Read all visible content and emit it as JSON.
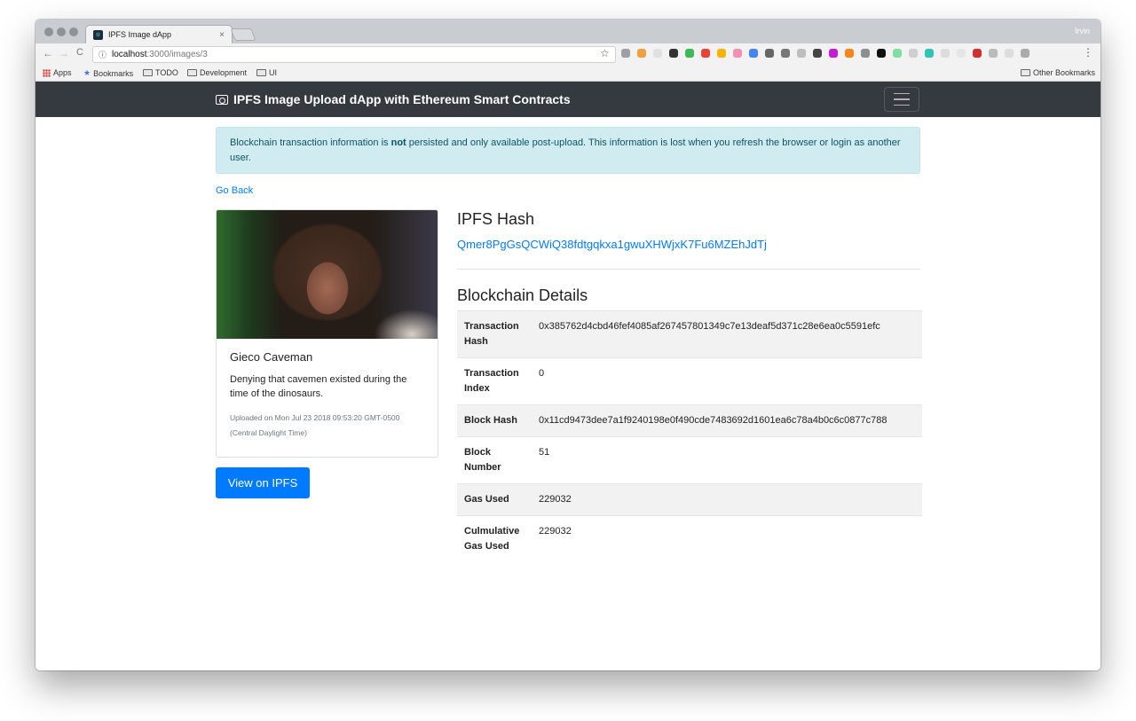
{
  "browser": {
    "tab_title": "IPFS Image dApp",
    "tab_close": "×",
    "profile_name": "Irvin",
    "url_host": "localhost",
    "url_path": ":3000/images/3",
    "bookmarks": [
      "Apps",
      "Bookmarks",
      "TODO",
      "Development",
      "UI"
    ],
    "other_bookmarks": "Other Bookmarks"
  },
  "navbar": {
    "brand": "IPFS Image Upload dApp with Ethereum Smart Contracts"
  },
  "alert": {
    "prefix": "Blockchain transaction information is ",
    "bold": "not",
    "suffix": " persisted and only available post-upload. This information is lost when you refresh the browser or login as another user."
  },
  "go_back": "Go Back",
  "card": {
    "title": "Gieco Caveman",
    "description": "Denying that cavemen existed during the time of the dinosaurs.",
    "uploaded": "Uploaded on Mon Jul 23 2018 09:53:20 GMT-0500 (Central Daylight Time)"
  },
  "view_button": "View on IPFS",
  "ipfs": {
    "heading": "IPFS Hash",
    "hash": "Qmer8PgGsQCWiQ38fdtgqkxa1gwuXHWjxK7Fu6MZEhJdTj"
  },
  "blockchain": {
    "heading": "Blockchain Details",
    "rows": [
      {
        "label": "Transaction Hash",
        "value": "0x385762d4cbd46fef4085af267457801349c7e13deaf5d371c28e6ea0c5591efc"
      },
      {
        "label": "Transaction Index",
        "value": "0"
      },
      {
        "label": "Block Hash",
        "value": "0x11cd9473dee7a1f9240198e0f490cde7483692d1601ea6c78a4b0c6c0877c788"
      },
      {
        "label": "Block Number",
        "value": "51"
      },
      {
        "label": "Gas Used",
        "value": "229032"
      },
      {
        "label": "Culmulative Gas Used",
        "value": "229032"
      }
    ]
  },
  "colors": {
    "navbar_bg": "#343a40",
    "link": "#007bff",
    "alert_bg": "#d1ecf1",
    "alert_text": "#0c5460"
  }
}
